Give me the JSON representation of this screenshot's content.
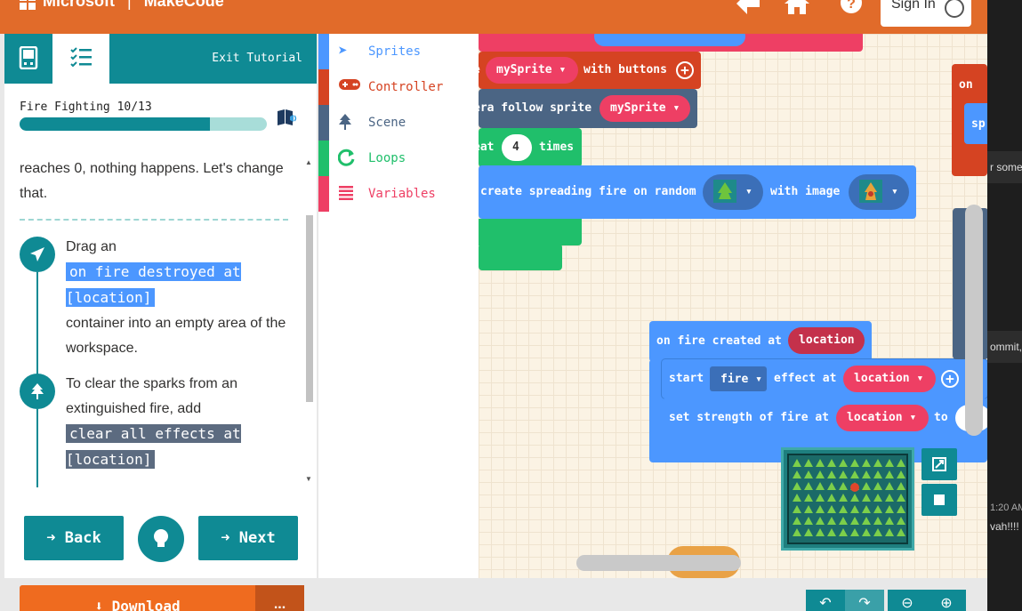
{
  "header": {
    "brand": "Microsoft",
    "product": "MakeCode",
    "sign_in": "Sign In"
  },
  "tutorial": {
    "exit_label": "Exit Tutorial",
    "title": "Fire Fighting 10/13",
    "progress_fraction": 0.769,
    "intro_text": "reaches 0, nothing happens. Let's change that.",
    "step1": {
      "prefix": "Drag an",
      "code": "on fire destroyed at [location]",
      "suffix": "container into an empty area of the workspace."
    },
    "step2": {
      "prefix": "To clear the sparks from an extinguished fire, add",
      "code": "clear all effects at [location]"
    },
    "back_label": "Back",
    "next_label": "Next",
    "download_label": "Download",
    "download_more": "..."
  },
  "toolbox": {
    "categories": [
      {
        "label": "Sprites",
        "color": "#4c97ff"
      },
      {
        "label": "Controller",
        "color": "#d54322"
      },
      {
        "label": "Scene",
        "color": "#4b6584"
      },
      {
        "label": "Loops",
        "color": "#20bf6b"
      },
      {
        "label": "Variables",
        "color": "#ee3f64"
      }
    ]
  },
  "workspace": {
    "move_block": {
      "var": "mySprite",
      "suffix": "with buttons",
      "prefix": "e"
    },
    "camera_block": {
      "text": "era follow sprite",
      "var": "mySprite"
    },
    "repeat_block": {
      "prefix": "eat",
      "count": "4",
      "suffix": "times"
    },
    "spread_block": {
      "text": "create spreading fire on random",
      "with": "with image"
    },
    "created_block": {
      "header": "on fire created at",
      "param": "location",
      "start_label": "start",
      "effect": "fire",
      "effect_at": "effect at",
      "effect_loc": "location",
      "set_label": "set strength of fire at",
      "set_loc": "location",
      "set_to": "to"
    },
    "right_block": {
      "label": "on",
      "sub": "sp"
    }
  },
  "background_app": {
    "texts": [
      "r some",
      "ommit,",
      "1:20 AM",
      "vah!!!! c"
    ]
  }
}
